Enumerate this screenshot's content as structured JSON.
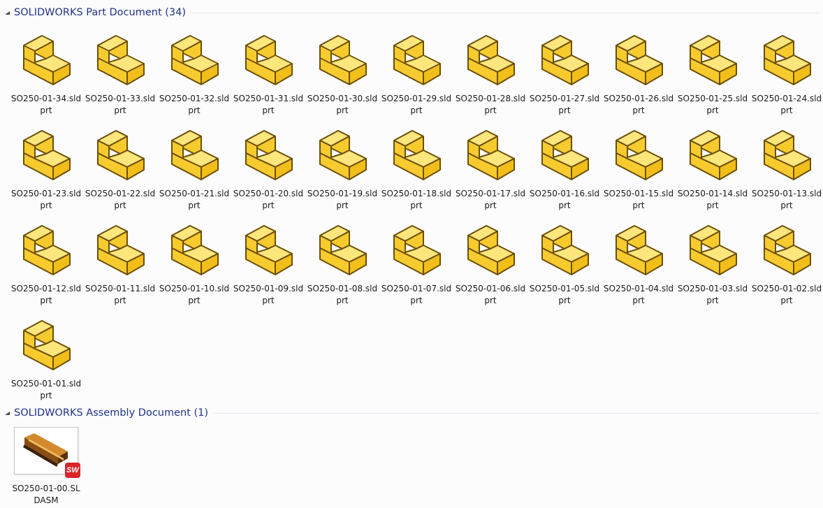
{
  "groups": [
    {
      "title": "SOLIDWORKS Part Document (34)",
      "icon": "solidworks-part-icon",
      "files": [
        {
          "name": "SO250-01-34.sldprt",
          "pixelated": true
        },
        {
          "name": "SO250-01-33.sldprt",
          "pixelated": true
        },
        {
          "name": "SO250-01-32.sldprt",
          "pixelated": true
        },
        {
          "name": "SO250-01-31.sldprt",
          "pixelated": true
        },
        {
          "name": "SO250-01-30.sldprt",
          "pixelated": true
        },
        {
          "name": "SO250-01-29.sldprt",
          "pixelated": true
        },
        {
          "name": "SO250-01-28.sldprt"
        },
        {
          "name": "SO250-01-27.sldprt"
        },
        {
          "name": "SO250-01-26.sldprt"
        },
        {
          "name": "SO250-01-25.sldprt"
        },
        {
          "name": "SO250-01-24.sldprt"
        },
        {
          "name": "SO250-01-23.sldprt"
        },
        {
          "name": "SO250-01-22.sldprt"
        },
        {
          "name": "SO250-01-21.sldprt"
        },
        {
          "name": "SO250-01-20.sldprt"
        },
        {
          "name": "SO250-01-19.sldprt"
        },
        {
          "name": "SO250-01-18.sldprt"
        },
        {
          "name": "SO250-01-17.sldprt"
        },
        {
          "name": "SO250-01-16.sldprt"
        },
        {
          "name": "SO250-01-15.sldprt"
        },
        {
          "name": "SO250-01-14.sldprt"
        },
        {
          "name": "SO250-01-13.sldprt"
        },
        {
          "name": "SO250-01-12.sldprt"
        },
        {
          "name": "SO250-01-11.sldprt"
        },
        {
          "name": "SO250-01-10.sldprt"
        },
        {
          "name": "SO250-01-09.sldprt"
        },
        {
          "name": "SO250-01-08.sldprt"
        },
        {
          "name": "SO250-01-07.sldprt"
        },
        {
          "name": "SO250-01-06.sldprt"
        },
        {
          "name": "SO250-01-05.sldprt"
        },
        {
          "name": "SO250-01-04.sldprt"
        },
        {
          "name": "SO250-01-03.sldprt"
        },
        {
          "name": "SO250-01-02.sldprt"
        },
        {
          "name": "SO250-01-01.sldprt"
        }
      ]
    },
    {
      "title": "SOLIDWORKS Assembly Document (1)",
      "icon": "solidworks-assembly-thumbnail",
      "files": [
        {
          "name": "SO250-01-00.SLDASM"
        }
      ]
    }
  ],
  "colors": {
    "group_title": "#1e3287",
    "part_face_top": "#fde67c",
    "part_face_front": "#f7cb2e",
    "part_face_side": "#f2be1a",
    "part_outline": "#6b4f08",
    "badge": "#d8262b"
  }
}
